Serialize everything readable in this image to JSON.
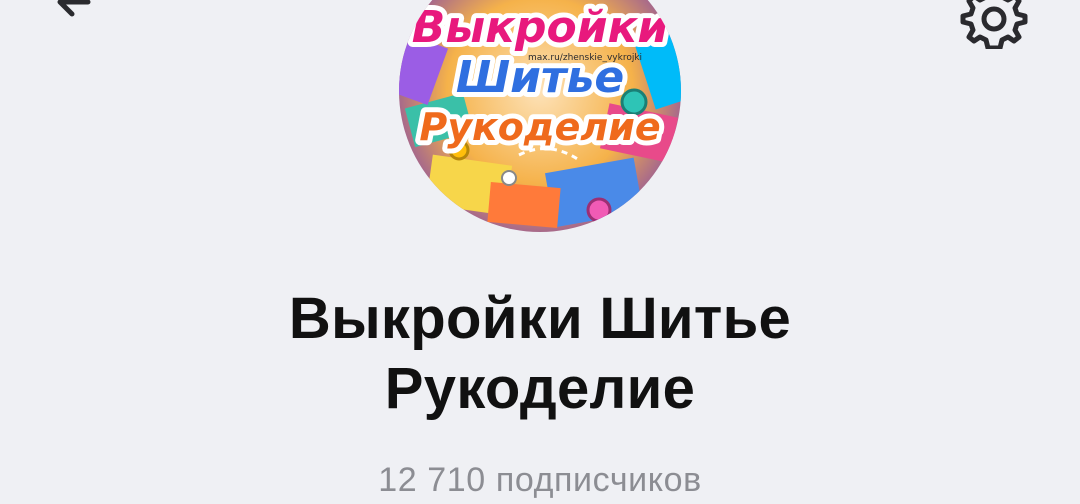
{
  "header": {
    "back_icon": "arrow-left-icon",
    "settings_icon": "gear-icon"
  },
  "avatar": {
    "line1": "Выкройки",
    "line2": "Шитье",
    "line3": "Рукоделие",
    "watermark": "max.ru/zhenskie_vykrojki",
    "colors": {
      "line1": "#e8197d",
      "line2": "#2f6fe0",
      "line3": "#ef6a1c"
    }
  },
  "channel": {
    "title_line1": "Выкройки Шитье",
    "title_line2": "Рукоделие",
    "subscribers": "12 710 подписчиков"
  }
}
